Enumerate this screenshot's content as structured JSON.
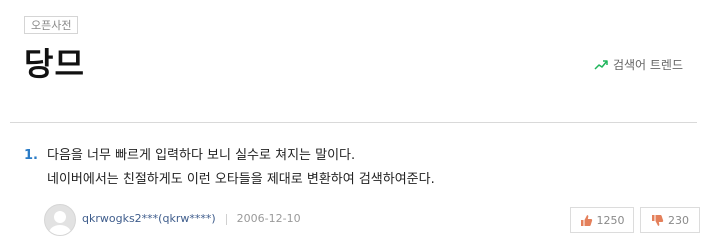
{
  "header": {
    "source_badge": "오픈사전",
    "entry_title": "당므",
    "trend_label": "검색어 트렌드"
  },
  "definition": {
    "number": "1.",
    "lines": [
      "다음을 너무 빠르게 입력하다 보니 실수로 쳐지는 말이다.",
      "네이버에서는 친절하게도 이런 오타들을 제대로 변환하여 검색하여준다."
    ]
  },
  "author": {
    "name": "qkrwogks2***(qkrw****)",
    "date": "2006-12-10"
  },
  "votes": {
    "up": "1250",
    "down": "230"
  },
  "colors": {
    "number": "#2a7bc6",
    "trend_icon": "#1fb55b",
    "author": "#3f5d8c",
    "thumb_up": "#e4805b",
    "thumb_down": "#e4805b"
  },
  "icons": {
    "trend": "trend-chart-icon",
    "avatar": "user-avatar-icon",
    "up": "thumb-up-icon",
    "down": "thumb-down-icon"
  }
}
